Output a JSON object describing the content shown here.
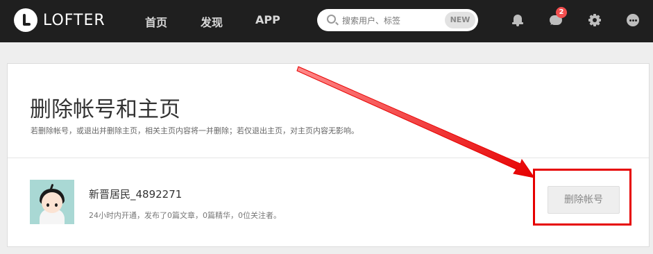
{
  "header": {
    "logo_text": "LOFTER",
    "nav": {
      "home": "首页",
      "discover": "发现",
      "app": "APP"
    },
    "search": {
      "placeholder": "搜索用户、标签",
      "badge": "NEW"
    },
    "icons": {
      "notifications": "bell-icon",
      "messages": "chat-bubble-icon",
      "settings": "gear-icon",
      "more": "more-icon"
    },
    "message_badge_count": "2"
  },
  "page": {
    "title": "删除帐号和主页",
    "description": "若删除帐号，或退出并删除主页，相关主页内容将一并删除；若仅退出主页，对主页内容无影响。"
  },
  "account": {
    "name": "新晋居民_4892271",
    "meta": "24小时内开通，发布了0篇文章，0篇精华，0位关注者。",
    "delete_button": "删除帐号"
  },
  "colors": {
    "topbar": "#1f1f1f",
    "annotation": "#e60000",
    "badge": "#f24e4e"
  }
}
